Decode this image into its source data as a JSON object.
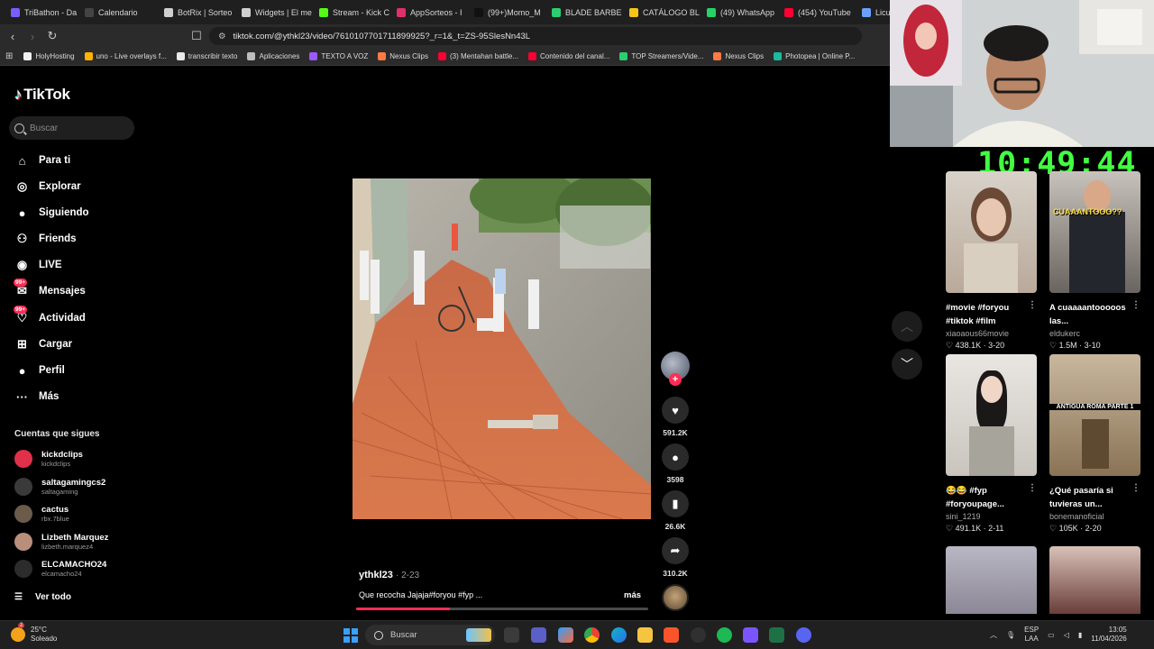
{
  "browser": {
    "tabs": [
      {
        "label": "TriBathon - Da",
        "color": "#7b5cff"
      },
      {
        "label": "Calendario",
        "color": "#444"
      },
      {
        "label": "BotRix | Sorteo",
        "color": "#cfcfcf"
      },
      {
        "label": "Widgets | El me",
        "color": "#cfcfcf"
      },
      {
        "label": "Stream - Kick C",
        "color": "#53fc18"
      },
      {
        "label": "AppSorteos - I",
        "color": "#e0306b"
      },
      {
        "label": "(99+)Momo_M",
        "color": "#111"
      },
      {
        "label": "BLADE BARBE",
        "color": "#2ecc71"
      },
      {
        "label": "CATÁLOGO BL",
        "color": "#f5c518"
      },
      {
        "label": "(49) WhatsApp",
        "color": "#25d366"
      },
      {
        "label": "(454) YouTube",
        "color": "#ff0033"
      },
      {
        "label": "Licu",
        "color": "#6aa0ff"
      }
    ],
    "url": "tiktok.com/@ythkl23/video/7610107701711899925?_r=1&_t=ZS-95SlesNn43L",
    "bookmarks": [
      {
        "label": "HolyHosting",
        "color": "#f1f1f1"
      },
      {
        "label": "uno - Live overlays f...",
        "color": "#ffb300"
      },
      {
        "label": "transcribir texto",
        "color": "#eaeaea"
      },
      {
        "label": "Aplicaciones",
        "color": "#bdbdbd"
      },
      {
        "label": "TEXTO A VOZ",
        "color": "#9b59ff"
      },
      {
        "label": "Nexus Clips",
        "color": "#ff7a45"
      },
      {
        "label": "(3) Mentahan battle...",
        "color": "#ff0033"
      },
      {
        "label": "Contenido del canal...",
        "color": "#ff0033"
      },
      {
        "label": "TOP Streamers/Vide...",
        "color": "#2ecc71"
      },
      {
        "label": "Nexus Clips",
        "color": "#ff7a45"
      },
      {
        "label": "Photopea | Online P...",
        "color": "#1abc9c"
      }
    ]
  },
  "tiktok": {
    "logo": "TikTok",
    "search_placeholder": "Buscar",
    "nav": [
      {
        "label": "Para ti",
        "icon": "home-icon",
        "glyph": "⌂"
      },
      {
        "label": "Explorar",
        "icon": "compass-icon",
        "glyph": "◎"
      },
      {
        "label": "Siguiendo",
        "icon": "following-avatar-icon",
        "glyph": "●"
      },
      {
        "label": "Friends",
        "icon": "friends-icon",
        "glyph": "⚇"
      },
      {
        "label": "LIVE",
        "icon": "live-icon",
        "glyph": "◉"
      },
      {
        "label": "Mensajes",
        "icon": "messages-icon",
        "glyph": "✉",
        "badge": "99+"
      },
      {
        "label": "Actividad",
        "icon": "activity-icon",
        "glyph": "♡",
        "badge": "99+"
      },
      {
        "label": "Cargar",
        "icon": "upload-icon",
        "glyph": "⊞"
      },
      {
        "label": "Perfil",
        "icon": "profile-icon",
        "glyph": "●"
      },
      {
        "label": "Más",
        "icon": "more-icon",
        "glyph": "···"
      }
    ],
    "following_title": "Cuentas que sigues",
    "following": [
      {
        "name": "kickdclips",
        "handle": "kickdclips",
        "color": "#e0304a"
      },
      {
        "name": "saltagamingcs2",
        "handle": "saltagaming",
        "color": "#3a3a3a"
      },
      {
        "name": "cactus",
        "handle": "rbx.7blue",
        "color": "#6b5b4a"
      },
      {
        "name": "Lizbeth Marquez",
        "handle": "lizbeth.marquez4",
        "color": "#b98f7c"
      },
      {
        "name": "ELCAMACHO24",
        "handle": "elcamacho24",
        "color": "#2c2c2c"
      }
    ],
    "see_all": "Ver todo",
    "video": {
      "username": "ythkl23",
      "date": "2-23",
      "caption": "Que recocha Jajaja#foryou #fyp ...",
      "more": "más",
      "progress_fraction": 0.32,
      "likes": "591.2K",
      "comments": "3598",
      "saves": "26.6K",
      "shares": "310.2K"
    }
  },
  "overlay": {
    "clock": "10:49:44"
  },
  "recommended": [
    {
      "title": "#movie #foryou #tiktok #film",
      "author": "xiaoaous66movie",
      "stats": "♡ 438.1K · 3-20",
      "overlay": ""
    },
    {
      "title": "A cuaaaantooooos las...",
      "author": "eldukerc",
      "stats": "♡ 1.5M · 3-10",
      "overlay": "CUAAANTOOO??"
    },
    {
      "title": "😂😂 #fyp #foryoupage...",
      "author": "sini_1219",
      "stats": "♡ 491.1K · 2-11",
      "overlay": ""
    },
    {
      "title": "¿Qué pasaría si tuvieras un...",
      "author": "bonemanoficial",
      "stats": "♡ 105K · 2-20",
      "overlay": "ANTIGUA ROMA PARTE 1"
    }
  ],
  "taskbar": {
    "weather_temp": "25°C",
    "weather_desc": "Soleado",
    "weather_badge": "2",
    "search_placeholder": "Buscar",
    "lang_top": "ESP",
    "lang_bottom": "LAA",
    "time": "13:05",
    "date": "11/04/2026"
  }
}
